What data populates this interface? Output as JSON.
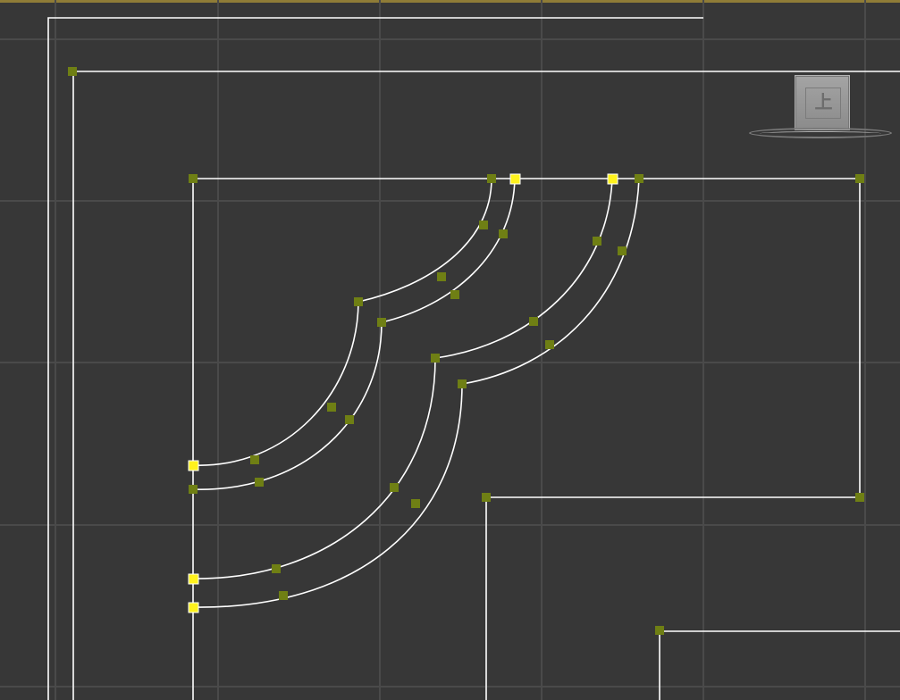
{
  "viewport": {
    "background_color": "#373737",
    "grid_color": "#4a4a4a",
    "frame_color": "#8f7c37",
    "spline_color": "#ffffff",
    "vertex_color": "#6f7f14",
    "selected_vertex_color": "#fff21d"
  },
  "viewcube": {
    "label": "上"
  }
}
